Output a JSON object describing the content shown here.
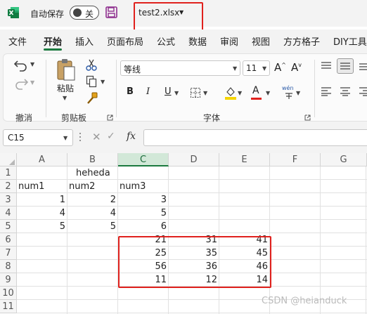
{
  "titlebar": {
    "app_icon": "excel-logo-icon",
    "autosave_label": "自动保存",
    "autosave_state": "关",
    "save_icon": "save-disk-icon",
    "filename": "test2.xlsx",
    "filename_menu_icon": "chevron-down-icon"
  },
  "menu": {
    "tabs": [
      "文件",
      "开始",
      "插入",
      "页面布局",
      "公式",
      "数据",
      "审阅",
      "视图",
      "方方格子",
      "DIY工具"
    ],
    "active_tab": "开始"
  },
  "ribbon": {
    "undo_group_label": "撤消",
    "clipboard": {
      "paste_label": "粘贴",
      "group_label": "剪贴板"
    },
    "font": {
      "font_name": "等线",
      "font_size": "11",
      "bold": "B",
      "italic": "I",
      "underline": "U",
      "group_label": "字体",
      "highlight_color": "#f5d400",
      "font_color": "#e0211d",
      "phonetic_label": "wén"
    }
  },
  "formula_bar": {
    "name_box": "C15",
    "fx_label": "fx",
    "formula": ""
  },
  "sheet": {
    "columns": [
      "A",
      "B",
      "C",
      "D",
      "E",
      "F",
      "G"
    ],
    "selected_column": "C",
    "rows": [
      "1",
      "2",
      "3",
      "4",
      "5",
      "6",
      "7",
      "8",
      "9",
      "10",
      "11"
    ],
    "cells": {
      "B1": "heheda",
      "A2": "num1",
      "B2": "num2",
      "C2": "num3",
      "A3": "1",
      "B3": "2",
      "C3": "3",
      "A4": "4",
      "B4": "4",
      "C4": "5",
      "A5": "5",
      "B5": "5",
      "C5": "6",
      "C6": "21",
      "D6": "31",
      "E6": "41",
      "C7": "25",
      "D7": "35",
      "E7": "45",
      "C8": "56",
      "D8": "36",
      "E8": "46",
      "C9": "11",
      "D9": "12",
      "E9": "14"
    }
  },
  "watermark": "CSDN @heianduck",
  "colors": {
    "accent_green": "#1b7a3f",
    "highlight_red": "#e0211d"
  }
}
